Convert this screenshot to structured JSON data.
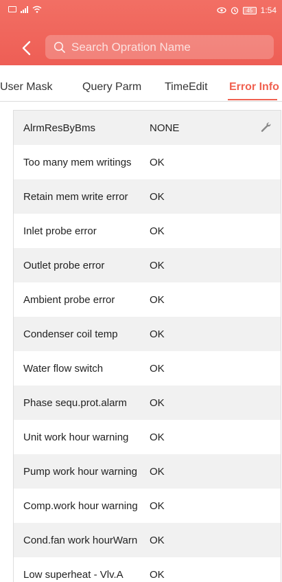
{
  "status_bar": {
    "time": "1:54",
    "battery": "45"
  },
  "search": {
    "placeholder": "Search Opration Name"
  },
  "tabs": [
    {
      "label": "User Mask",
      "active": false
    },
    {
      "label": "Query Parm",
      "active": false
    },
    {
      "label": "TimeEdit",
      "active": false
    },
    {
      "label": "Error Info",
      "active": true
    }
  ],
  "rows": [
    {
      "name": "AlrmResByBms",
      "value": "NONE",
      "editable": true
    },
    {
      "name": "Too many mem writings",
      "value": "OK"
    },
    {
      "name": "Retain mem write error",
      "value": "OK"
    },
    {
      "name": "Inlet probe error",
      "value": "OK"
    },
    {
      "name": "Outlet probe error",
      "value": "OK"
    },
    {
      "name": "Ambient probe error",
      "value": "OK"
    },
    {
      "name": "Condenser coil temp",
      "value": "OK"
    },
    {
      "name": "Water flow switch",
      "value": "OK"
    },
    {
      "name": "Phase sequ.prot.alarm",
      "value": "OK"
    },
    {
      "name": "Unit work hour warning",
      "value": "OK"
    },
    {
      "name": "Pump work hour warning",
      "value": "OK"
    },
    {
      "name": "Comp.work hour warning",
      "value": "OK"
    },
    {
      "name": "Cond.fan work hourWarn",
      "value": "OK"
    },
    {
      "name": "Low superheat - Vlv.A",
      "value": "OK"
    }
  ],
  "colors": {
    "header": "#ee5e55",
    "accent": "#f0604f",
    "row_alt": "#f1f1f1"
  }
}
